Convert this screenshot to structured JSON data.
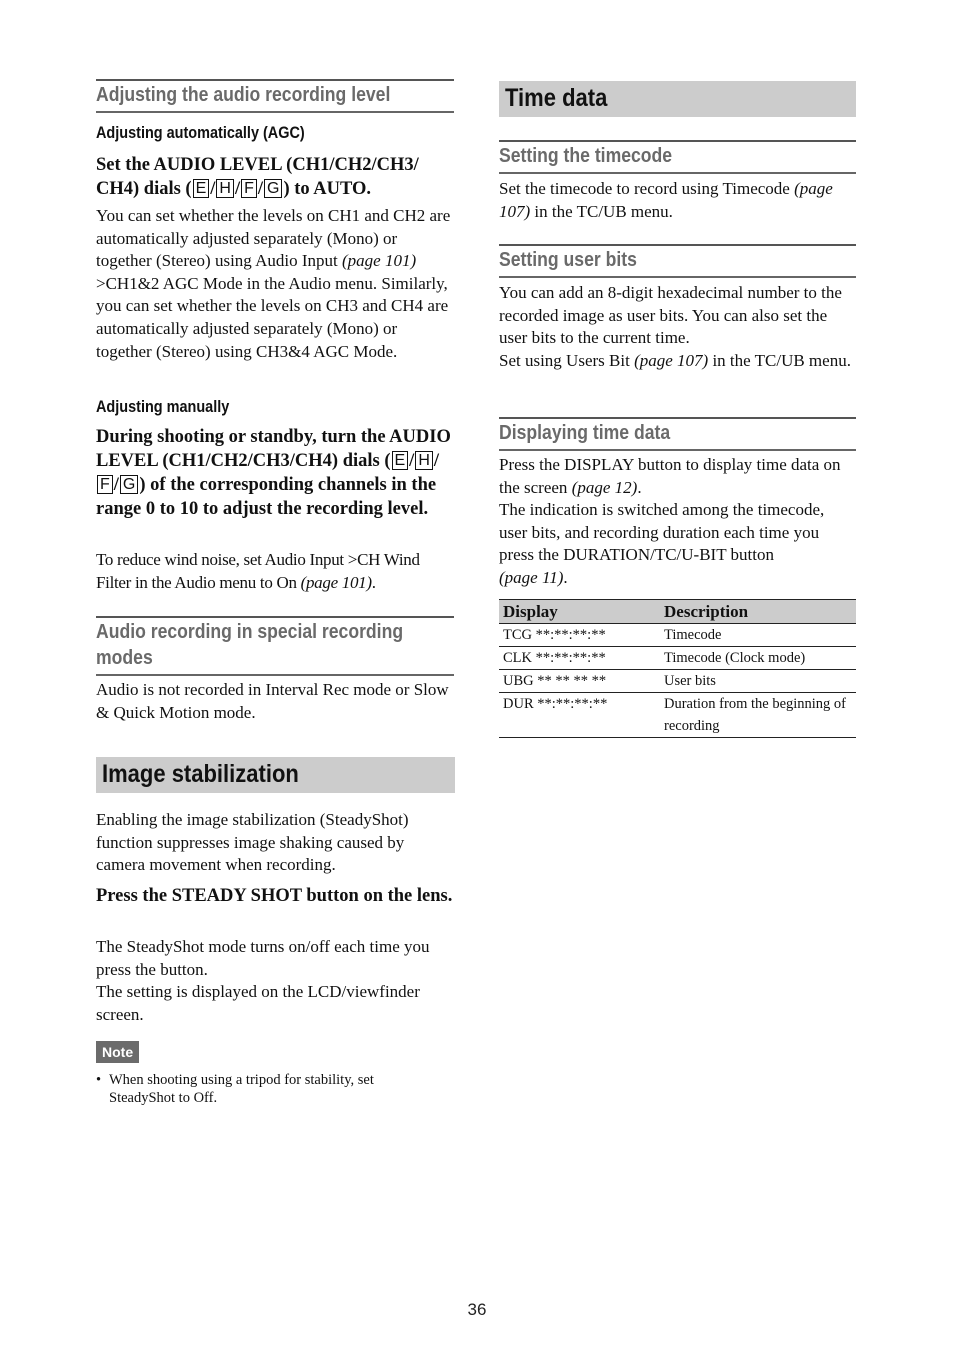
{
  "left": {
    "audio_level": {
      "heading": "Adjusting the audio recording level",
      "agc_subheading": "Adjusting automatically (AGC)",
      "agc_step": {
        "before": "Set the AUDIO LEVEL (CH1/CH2/CH3/ CH4) dials (",
        "keys": [
          "E",
          "H",
          "F",
          "G"
        ],
        "after": ") to AUTO."
      },
      "agc_body": {
        "part1": "You can set whether the levels on CH1 and CH2 are automatically adjusted separately (Mono) or together (Stereo) using Audio Input ",
        "ref": "(page 101)",
        "part2": " >CH1&2 AGC Mode in the Audio menu. Similarly, you can set whether the levels on CH3 and CH4 are automatically adjusted separately (Mono) or together (Stereo) using CH3&4 AGC Mode."
      },
      "manual_subheading": "Adjusting manually",
      "manual_step": {
        "before": "During shooting or standby, turn the AUDIO LEVEL (CH1/CH2/CH3/CH4) dials (",
        "keys": [
          "E",
          "H",
          "F",
          "G"
        ],
        "after": ") of the corresponding channels in the range 0 to 10 to adjust the recording level."
      },
      "manual_body": {
        "part1": "To reduce wind noise, set Audio Input >CH Wind Filter in the Audio menu to On ",
        "ref": "(page 101)",
        "part2": "."
      }
    },
    "special_modes": {
      "heading": "Audio recording in special recording modes",
      "body": "Audio is not recorded in Interval Rec mode or Slow & Quick Motion mode."
    },
    "stabilization": {
      "heading": "Image stabilization",
      "intro": "Enabling the image stabilization (SteadyShot) function suppresses image shaking caused by camera movement when recording.",
      "step": "Press the STEADY SHOT button on the lens.",
      "body1": "The SteadyShot mode turns on/off each time you press the button.",
      "body2": "The setting is displayed on the LCD/viewfinder screen.",
      "note_label": "Note",
      "notes": [
        "When shooting using a tripod for stability, set SteadyShot to Off."
      ]
    }
  },
  "right": {
    "time_data": {
      "heading": "Time data",
      "timecode": {
        "heading": "Setting the timecode",
        "part1": "Set the timecode to record using Timecode ",
        "ref": "(page 107)",
        "part2": " in the TC/UB menu."
      },
      "user_bits": {
        "heading": "Setting user bits",
        "body1": "You can add an 8-digit hexadecimal number to the recorded image as user bits. You can also set the user bits to the current time.",
        "part1": "Set using Users Bit ",
        "ref": "(page 107)",
        "part2": " in the TC/UB menu."
      },
      "displaying": {
        "heading": "Displaying time data",
        "part1": "Press the DISPLAY button to display time data on the screen ",
        "ref1": "(page 12)",
        "part2": ".",
        "part3": "The indication is switched among the timecode, user bits, and recording duration each time you press the DURATION/TC/U-BIT button ",
        "ref2": "(page 11)",
        "part4": "."
      },
      "table": {
        "headers": [
          "Display",
          "Description"
        ],
        "rows": [
          [
            "TCG **:**:**:**",
            "Timecode"
          ],
          [
            "CLK **:**:**:**",
            "Timecode (Clock mode)"
          ],
          [
            "UBG ** ** ** **",
            "User bits"
          ],
          [
            "DUR **:**:**:**",
            "Duration from the beginning of recording"
          ]
        ]
      }
    }
  },
  "page_number": "36"
}
